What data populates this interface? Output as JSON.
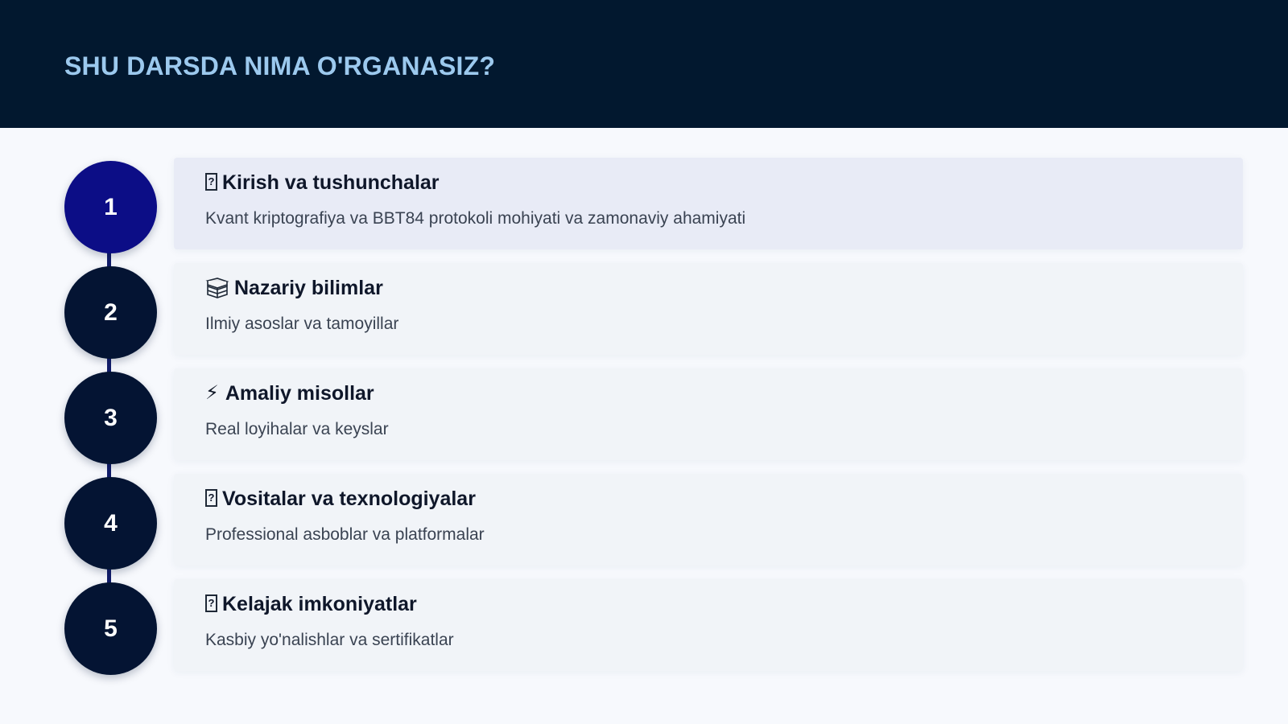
{
  "header": {
    "title": "SHU DARSDA NIMA O'RGANASIZ?"
  },
  "steps": [
    {
      "number": "1",
      "icon": "unknown-glyph-icon",
      "icon_glyph": "?",
      "title": "Kirish va tushunchalar",
      "description": "Kvant kriptografiya va BBT84 protokoli mohiyati va zamonaviy ahamiyati",
      "active": true
    },
    {
      "number": "2",
      "icon": "books-icon",
      "title": "Nazariy bilimlar",
      "description": "Ilmiy asoslar va tamoyillar",
      "active": false
    },
    {
      "number": "3",
      "icon": "lightning-icon",
      "icon_glyph": "⚡",
      "title": "Amaliy misollar",
      "description": "Real loyihalar va keyslar",
      "active": false
    },
    {
      "number": "4",
      "icon": "unknown-glyph-icon",
      "icon_glyph": "?",
      "title": "Vositalar va texnologiyalar",
      "description": "Professional asboblar va platformalar",
      "active": false
    },
    {
      "number": "5",
      "icon": "unknown-glyph-icon",
      "icon_glyph": "?",
      "title": "Kelajak imkoniyatlar",
      "description": "Kasbiy yo'nalishlar va sertifikatlar",
      "active": false
    }
  ],
  "colors": {
    "header_background": "#02182f",
    "title_color": "#9cc9ee",
    "active_circle": "#0c0d86",
    "circle": "#041433",
    "connector": "#121d6b",
    "active_card": "#e8ebf6",
    "card": "#f1f4f8"
  }
}
